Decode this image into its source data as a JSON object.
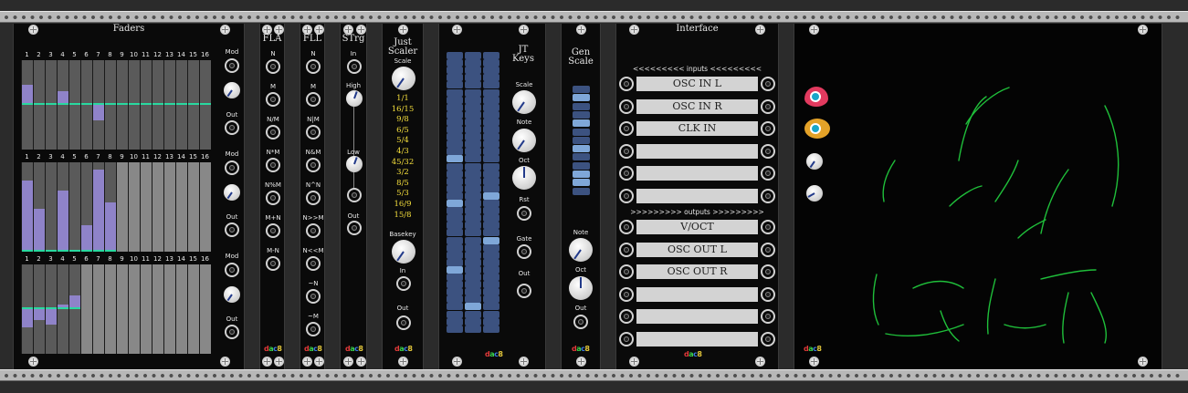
{
  "faders": {
    "title": "Faders",
    "numbers": [
      "1",
      "2",
      "3",
      "4",
      "5",
      "6",
      "7",
      "8",
      "9",
      "10",
      "11",
      "12",
      "13",
      "14",
      "15",
      "16"
    ],
    "mod_label": "Mod",
    "out_label": "Out",
    "rows": [
      {
        "levels": [
          0.45,
          0,
          0,
          0.3,
          0,
          0,
          -0.35,
          0,
          0,
          0,
          0,
          0,
          0,
          0,
          0,
          0
        ],
        "active": 16
      },
      {
        "levels": [
          0.8,
          0.48,
          0,
          0.68,
          0,
          0.3,
          0.92,
          0.55,
          0,
          0,
          0,
          0,
          0,
          0,
          0,
          0
        ],
        "active": 8
      },
      {
        "levels": [
          -0.4,
          -0.25,
          -0.35,
          0.1,
          0.3,
          0,
          0,
          0,
          0,
          0,
          0,
          0,
          0,
          0,
          0,
          0
        ],
        "active": 5
      }
    ]
  },
  "fla": {
    "title": "FLA",
    "labels": [
      "N",
      "M",
      "N/M",
      "N*M",
      "N%M",
      "M+N",
      "M-N"
    ]
  },
  "fll": {
    "title": "FLL",
    "labels": [
      "N",
      "M",
      "N|M",
      "N&M",
      "N^N",
      "N>>M",
      "N<<M",
      "~N",
      "~M"
    ]
  },
  "strg": {
    "title": "STrg",
    "labels": [
      "In",
      "High",
      "Low",
      "Out"
    ]
  },
  "just_scaler": {
    "title": "Just Scaler",
    "scale_label": "Scale",
    "ratios": [
      "1/1",
      "16/15",
      "9/8",
      "6/5",
      "5/4",
      "4/3",
      "45/32",
      "3/2",
      "8/5",
      "5/3",
      "16/9",
      "15/8"
    ],
    "basekey_label": "Basekey",
    "in_label": "In",
    "out_label": "Out"
  },
  "jt_keys": {
    "title": "JT Keys",
    "labels": [
      "Scale",
      "Note",
      "Oct",
      "Rst",
      "Gate",
      "Out"
    ]
  },
  "gen_scale": {
    "title": "Gen Scale",
    "labels": [
      "Note",
      "Oct",
      "Out"
    ]
  },
  "interface": {
    "title": "Interface",
    "inputs_header": "<<<<<<<<< inputs <<<<<<<<<",
    "outputs_header": ">>>>>>>>> outputs >>>>>>>>>",
    "inputs": [
      "OSC IN L",
      "OSC IN R",
      "CLK IN",
      "",
      "",
      ""
    ],
    "outputs": [
      "V/OCT",
      "OSC OUT L",
      "OSC OUT R",
      "",
      "",
      ""
    ]
  },
  "logo": {
    "text": "dac8"
  },
  "colors": {
    "fader_fill": "#8f83c9",
    "fader_tick": "#29d9a0",
    "scale_text": "#f5df3c",
    "grid_on": "#7fa7d8",
    "grid_off": "#3c5280",
    "scope_trace": "#1fbf3a"
  }
}
